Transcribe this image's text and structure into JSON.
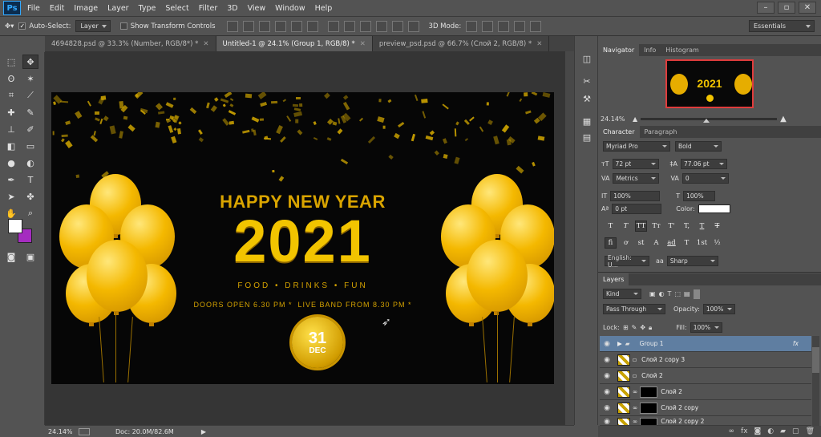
{
  "app": {
    "logo": "Ps"
  },
  "menu": [
    "File",
    "Edit",
    "Image",
    "Layer",
    "Type",
    "Select",
    "Filter",
    "3D",
    "View",
    "Window",
    "Help"
  ],
  "options": {
    "auto_select_label": "Auto-Select:",
    "auto_select_value": "Layer",
    "show_transform_label": "Show Transform Controls",
    "mode_3d_label": "3D Mode:",
    "workspace": "Essentials"
  },
  "doc_tabs": [
    {
      "label": "4694828.psd @ 33.3% (Number, RGB/8*) *",
      "active": false
    },
    {
      "label": "Untitled-1 @ 24.1% (Group 1, RGB/8) *",
      "active": true
    },
    {
      "label": "preview_psd.psd @ 66.7% (Слой 2, RGB/8) *",
      "active": false
    }
  ],
  "canvas": {
    "headline": "HAPPY NEW YEAR",
    "year": "2021",
    "tagline": "FOOD • DRINKS • FUN",
    "info_line": "DOORS OPEN 6.30 PM *  LIVE BAND FROM 8.30 PM *",
    "badge_day": "31",
    "badge_month": "DEC",
    "colors": {
      "gold": "#f2c400",
      "background": "#060606"
    }
  },
  "status": {
    "zoom": "24.14%",
    "doc": "Doc: 20.0M/82.6M"
  },
  "navigator": {
    "tabs": [
      "Navigator",
      "Info",
      "Histogram"
    ],
    "zoom": "24.14%",
    "zoom_fraction": 0.48
  },
  "character": {
    "tabs": [
      "Character",
      "Paragraph"
    ],
    "font_family": "Myriad Pro",
    "font_style": "Bold",
    "size": "72 pt",
    "leading": "77.06 pt",
    "kerning": "Metrics",
    "tracking": "0",
    "vscale": "100%",
    "hscale": "100%",
    "baseline": "0 pt",
    "color_label": "Color:",
    "text_color": "#ffffff",
    "style_buttons": [
      "T",
      "T",
      "TT",
      "Tт",
      "T'",
      "T,",
      "T",
      "T"
    ],
    "ot_buttons": [
      "fi",
      "ơ",
      "st",
      "A",
      "ad",
      "T",
      "1st",
      "½"
    ],
    "language": "English: U...",
    "antialias_icon": "aa",
    "antialias": "Sharp"
  },
  "layers": {
    "title": "Layers",
    "filter": "Kind",
    "blend_mode": "Pass Through",
    "opacity_label": "Opacity:",
    "opacity": "100%",
    "lock_label": "Lock:",
    "fill_label": "Fill:",
    "fill": "100%",
    "items": [
      {
        "name": "Group 1",
        "type": "group",
        "selected": true,
        "fx": "fx"
      },
      {
        "name": "Слой 2 copy 3",
        "type": "layer",
        "selected": false
      },
      {
        "name": "Слой 2",
        "type": "layer",
        "selected": false
      },
      {
        "name": "Слой 2",
        "type": "masked",
        "selected": false
      },
      {
        "name": "Слой 2 copy",
        "type": "masked",
        "selected": false
      },
      {
        "name": "Слой 2 copy 2",
        "type": "masked",
        "selected": false
      }
    ]
  }
}
